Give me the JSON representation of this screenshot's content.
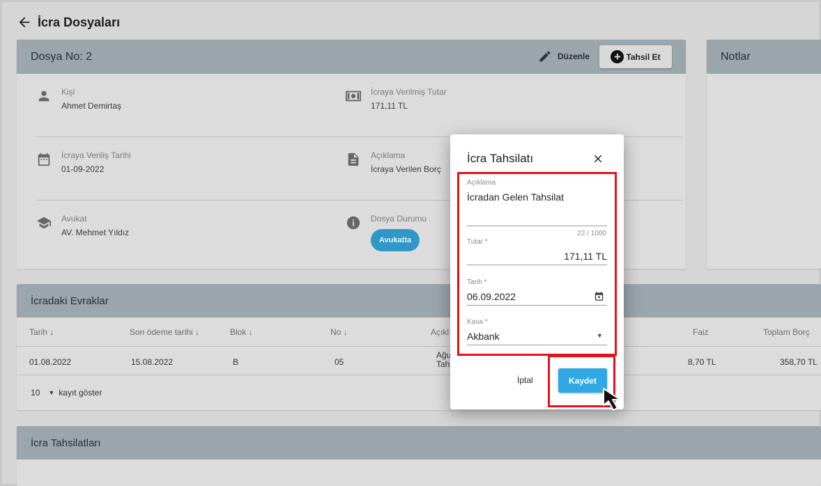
{
  "page": {
    "title": "İcra Dosyaları"
  },
  "file_card": {
    "title": "Dosya No: 2",
    "edit_label": "Düzenle",
    "collect_label": "Tahsil Et",
    "fields": {
      "person": {
        "label": "Kişi",
        "value": "Ahmet Demirtaş"
      },
      "amount": {
        "label": "İcraya Verilmiş Tutar",
        "value": "171,11 TL"
      },
      "date": {
        "label": "İcraya Veriliş Tarihi",
        "value": "01-09-2022"
      },
      "description": {
        "label": "Açıklama",
        "value": "İcraya Verilen Borç"
      },
      "lawyer": {
        "label": "Avukat",
        "value": "AV. Mehmet Yıldız"
      },
      "status": {
        "label": "Dosya Durumu",
        "value": "Avukatta"
      }
    }
  },
  "notes_card": {
    "title": "Notlar"
  },
  "documents": {
    "title": "İcradaki Evraklar",
    "columns": [
      "Tarih",
      "Son ödeme tarihi",
      "Blok",
      "No",
      "Açıkl",
      "Faiz",
      "Toplam Borç"
    ],
    "rows": [
      {
        "date": "01.08.2022",
        "due": "15.08.2022",
        "block": "B",
        "no": "05",
        "desc1": "Ağu",
        "desc2": "Tah",
        "interest": "8,70 TL",
        "total": "358,70 TL"
      }
    ],
    "page_size": "10",
    "page_size_label": "kayıt göster"
  },
  "collections": {
    "title": "İcra Tahsilatları"
  },
  "dialog": {
    "title": "İcra Tahsilatı",
    "description": {
      "label": "Açıklama",
      "value": "İcradan Gelen Tahsilat",
      "counter": "22 / 1000"
    },
    "amount": {
      "label": "Tutar *",
      "value": "171,11 TL"
    },
    "date": {
      "label": "Tarih *",
      "value": "06.09.2022"
    },
    "cashbox": {
      "label": "Kasa *",
      "value": "Akbank"
    },
    "cancel_label": "İptal",
    "save_label": "Kaydet"
  },
  "colors": {
    "accent": "#2fa8e3",
    "badge": "#2f98c7",
    "highlight": "#e8101a",
    "header": "#9aa5ac"
  }
}
